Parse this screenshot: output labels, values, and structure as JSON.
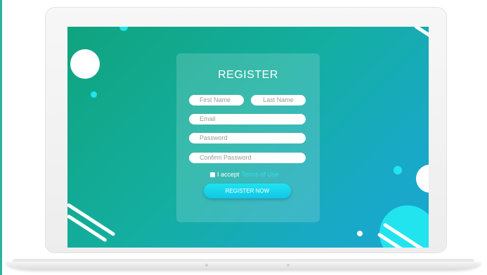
{
  "register_form": {
    "title": "REGISTER",
    "first_name_placeholder": "First Name",
    "last_name_placeholder": "Last Name",
    "email_placeholder": "Email",
    "password_placeholder": "Password",
    "confirm_password_placeholder": "Confirm Password",
    "terms_prefix": "I accept",
    "terms_link": "Terms of Use",
    "submit_label": "REGISTER NOW"
  },
  "colors": {
    "gradient_start": "#0fa37e",
    "gradient_end": "#1aa6d2",
    "accent_cyan": "#1fe3f1",
    "terms_link": "#35e0f0"
  }
}
